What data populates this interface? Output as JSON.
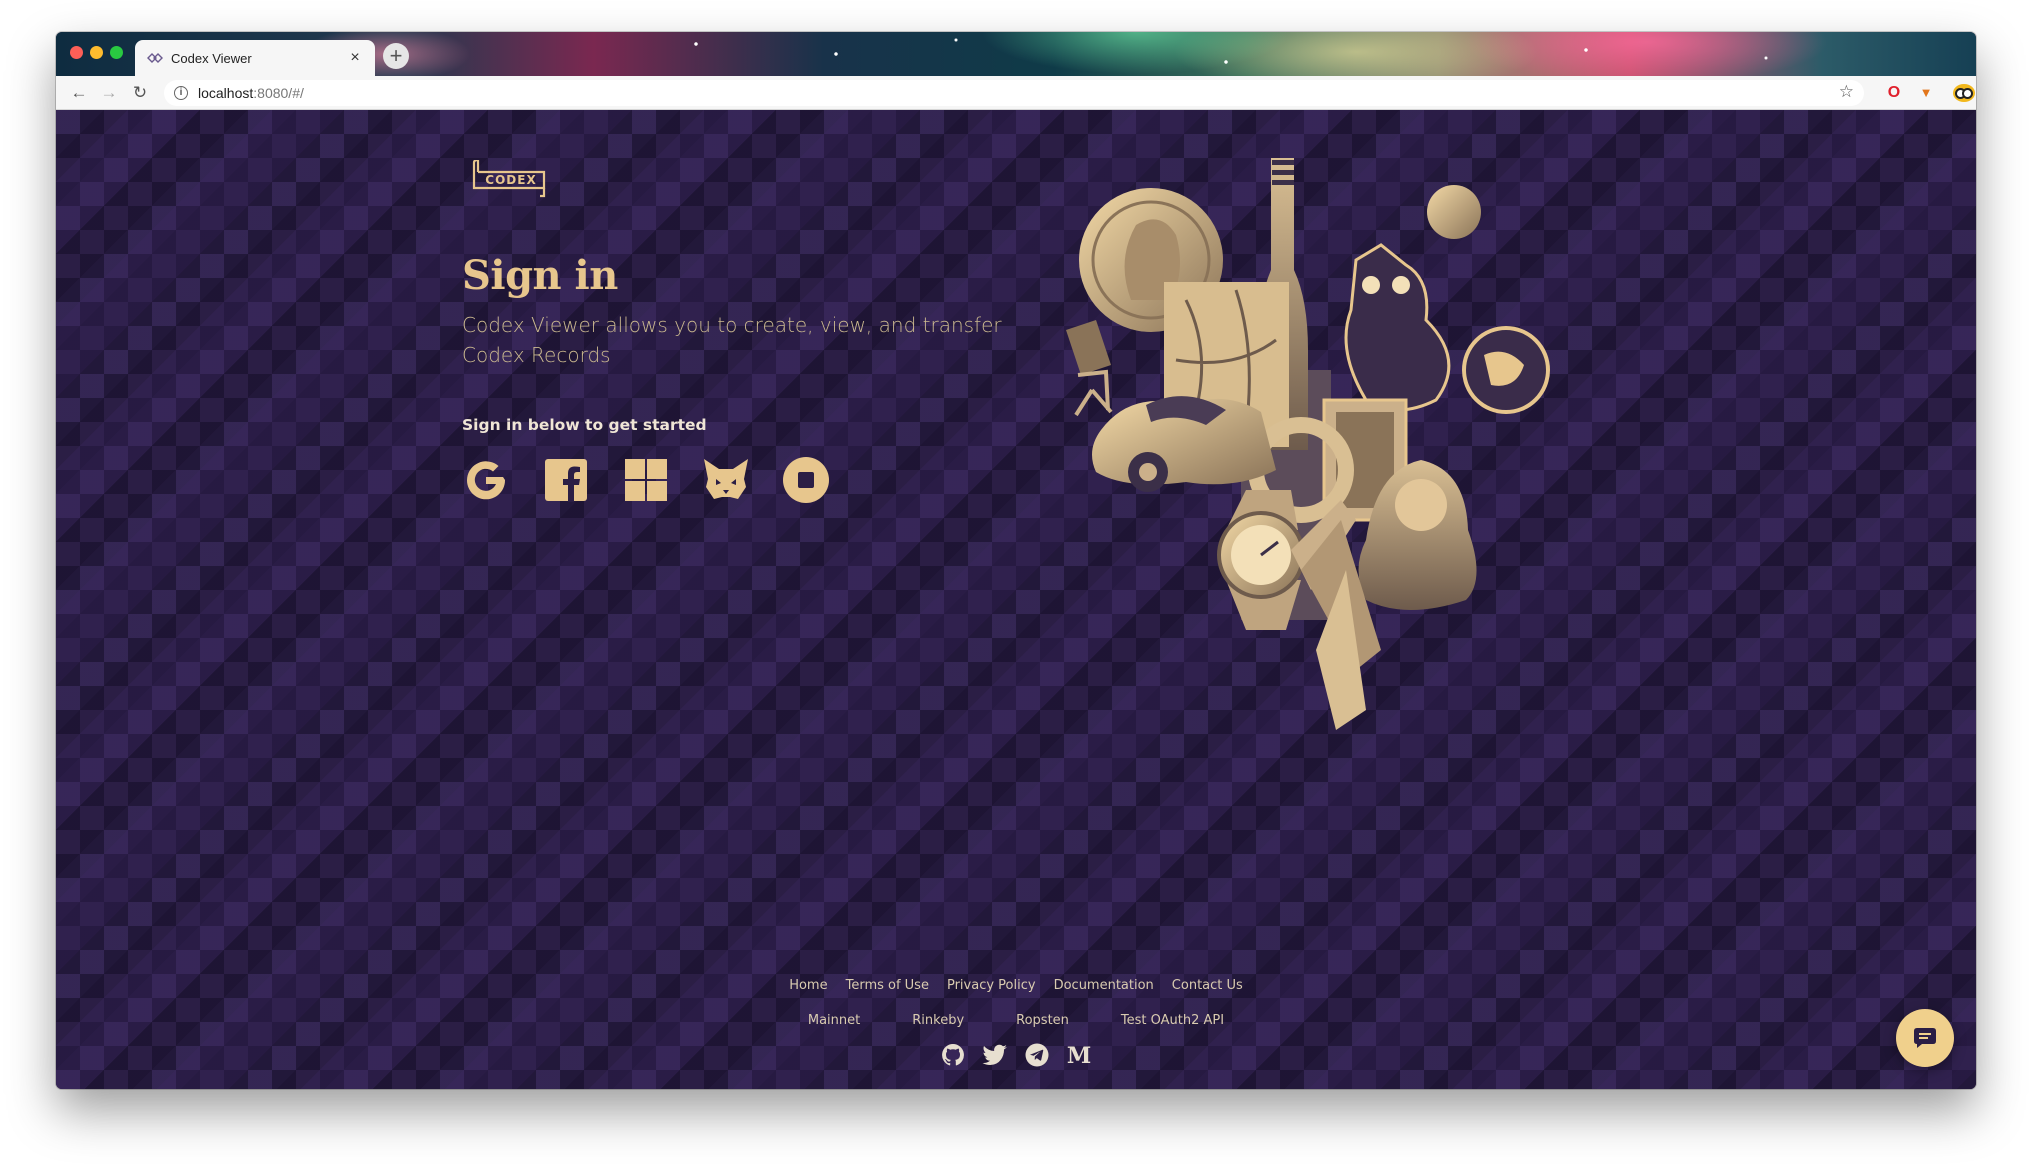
{
  "browser": {
    "tab_title": "Codex Viewer",
    "url_host": "localhost",
    "url_rest": ":8080/#/"
  },
  "page": {
    "logo_text": "CODEX",
    "heading": "Sign in",
    "description": "Codex Viewer allows you to create, view, and transfer Codex Records",
    "signin_prompt": "Sign in below to get started",
    "providers": [
      "google-icon",
      "facebook-icon",
      "windows-icon",
      "metamask-fox-icon",
      "coinbase-icon"
    ]
  },
  "footer": {
    "links": [
      "Home",
      "Terms of Use",
      "Privacy Policy",
      "Documentation",
      "Contact Us"
    ],
    "networks": [
      "Mainnet",
      "Rinkeby",
      "Ropsten",
      "Test OAuth2 API"
    ],
    "social": [
      "github-icon",
      "twitter-icon",
      "telegram-icon",
      "medium-icon"
    ]
  },
  "colors": {
    "accent": "#e7c68d",
    "background": "#2b1e45"
  }
}
